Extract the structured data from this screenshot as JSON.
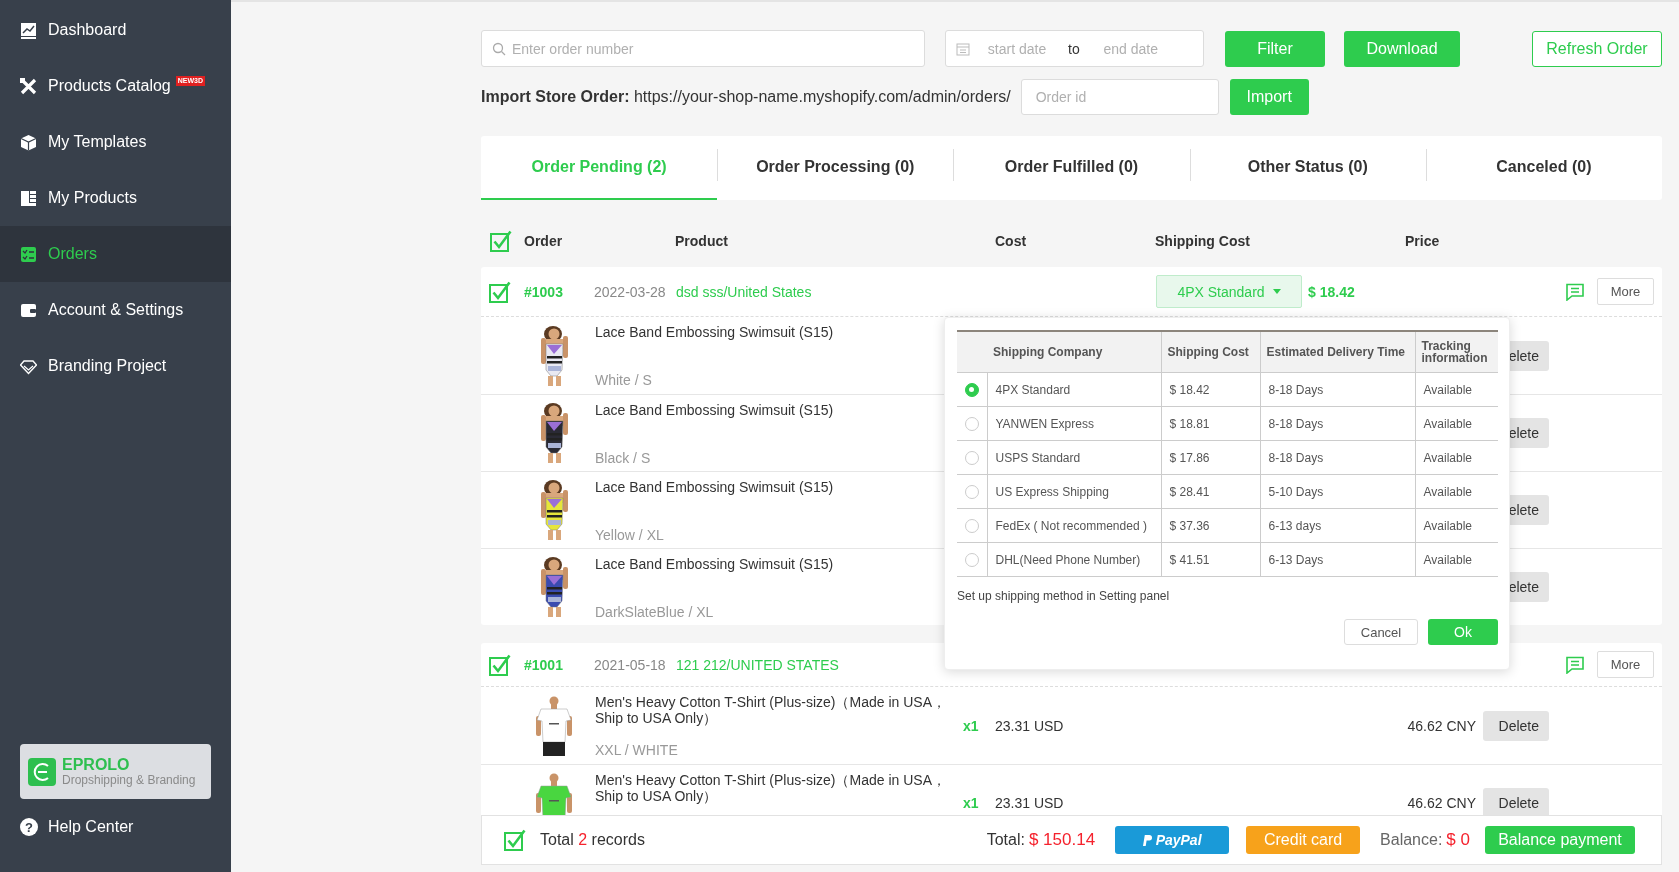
{
  "sidebar": {
    "items": [
      {
        "label": "Dashboard",
        "selected": false
      },
      {
        "label": "Products Catalog",
        "selected": false,
        "badge": "NEW3D"
      },
      {
        "label": "My Templates",
        "selected": false
      },
      {
        "label": "My Products",
        "selected": false
      },
      {
        "label": "Orders",
        "selected": true
      },
      {
        "label": "Account & Settings",
        "selected": false
      },
      {
        "label": "Branding Project",
        "selected": false
      }
    ],
    "brand": {
      "name": "EPROLO",
      "tagline": "Dropshipping & Branding"
    },
    "help": {
      "icon": "?",
      "label": "Help Center"
    }
  },
  "toolbar": {
    "search_placeholder": "Enter order number",
    "start_placeholder": "start date",
    "separator": "to",
    "end_placeholder": "end date",
    "filter": "Filter",
    "download": "Download",
    "refresh": "Refresh Order"
  },
  "import": {
    "text": "**Import Store Order:** https://your-shop-name.myshopify.com/admin/orders/",
    "placeholder": "Order id",
    "button": "Import"
  },
  "tabs": [
    {
      "label": "Order Pending (2)",
      "selected": true
    },
    {
      "label": "Order Processing (0)",
      "selected": false
    },
    {
      "label": "Order Fulfilled (0)",
      "selected": false
    },
    {
      "label": "Other Status (0)",
      "selected": false
    },
    {
      "label": "Canceled (0)",
      "selected": false
    }
  ],
  "table": {
    "checked": true,
    "columns": [
      "Order",
      "Product",
      "Cost",
      "Shipping Cost",
      "Price"
    ]
  },
  "orders": [
    {
      "checked": true,
      "number": "#1003",
      "date": "2022-03-28",
      "customer": "dsd sss/United States",
      "shipping": {
        "method": "4PX Standard",
        "price": "$ 18.42"
      },
      "more": "More",
      "items": [
        {
          "name": "Lace Band Embossing Swimsuit (S15)",
          "variant": "White / S",
          "delete": "elete"
        },
        {
          "name": "Lace Band Embossing Swimsuit (S15)",
          "variant": "Black / S",
          "delete": "elete"
        },
        {
          "name": "Lace Band Embossing Swimsuit (S15)",
          "variant": "Yellow / XL",
          "delete": "elete"
        },
        {
          "name": "Lace Band Embossing Swimsuit (S15)",
          "variant": "DarkSlateBlue / XL",
          "delete": "elete"
        }
      ]
    },
    {
      "checked": true,
      "number": "#1001",
      "date": "2021-05-18",
      "customer": "121 212/UNITED STATES",
      "more": "More",
      "items": [
        {
          "name": "Men's Heavy Cotton T-Shirt (Plus-size)（Made in USA，Ship to USA Only）",
          "variant": "XXL / WHITE",
          "qty": "x1",
          "cost": "23.31 USD",
          "price": "46.62 CNY",
          "delete": "Delete"
        },
        {
          "name": "Men's Heavy Cotton T-Shirt (Plus-size)（Made in USA，Ship to USA Only）",
          "qty": "x1",
          "cost": "23.31 USD",
          "price": "46.62 CNY",
          "delete": "Delete"
        }
      ]
    }
  ],
  "popup": {
    "columns": [
      "Shipping Company",
      "Shipping Cost",
      "Estimated Delivery Time",
      "Tracking information"
    ],
    "rows": [
      {
        "selected": true,
        "company": "4PX Standard",
        "cost": "$ 18.42",
        "time": "8-18 Days",
        "tracking": "Available"
      },
      {
        "selected": false,
        "company": "YANWEN Express",
        "cost": "$ 18.81",
        "time": "8-18 Days",
        "tracking": "Available"
      },
      {
        "selected": false,
        "company": "USPS Standard",
        "cost": "$ 17.86",
        "time": "8-18 Days",
        "tracking": "Available"
      },
      {
        "selected": false,
        "company": "US Express Shipping",
        "cost": "$ 28.41",
        "time": "5-10 Days",
        "tracking": "Available"
      },
      {
        "selected": false,
        "company": "FedEx ( Not recommended )",
        "cost": "$ 37.36",
        "time": "6-13 days",
        "tracking": "Available"
      },
      {
        "selected": false,
        "company": "DHL(Need Phone Number)",
        "cost": "$ 41.51",
        "time": "6-13 Days",
        "tracking": "Available"
      }
    ],
    "note": "Set up shipping method in Setting panel",
    "cancel": "Cancel",
    "ok": "Ok"
  },
  "footer": {
    "checked": true,
    "records_prefix": "Total",
    "records_count": "2",
    "records_suffix": "records",
    "total_label": "Total:",
    "total": "$ 150.14",
    "paypal": "PayPal",
    "credit": "Credit card",
    "balance_label": "Balance:",
    "balance": "$ 0",
    "balance_button": "Balance payment"
  }
}
